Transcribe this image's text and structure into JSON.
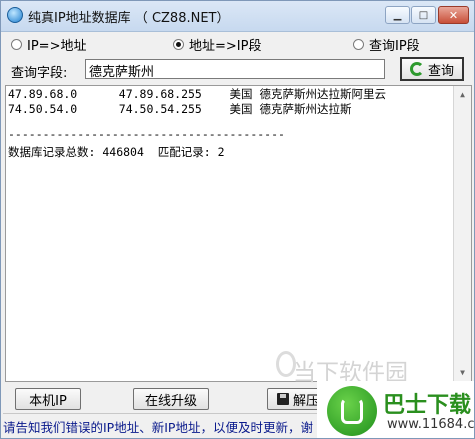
{
  "window": {
    "title": "纯真IP地址数据库 （ CZ88.NET）",
    "min_icon": "minimize-icon",
    "max_icon": "maximize-icon",
    "close_icon": "close-icon",
    "min_glyph": "▁",
    "max_glyph": "□",
    "close_glyph": "✕"
  },
  "modes": [
    {
      "label": "IP=>地址",
      "selected": false
    },
    {
      "label": "地址=>IP段",
      "selected": true
    },
    {
      "label": "查询IP段",
      "selected": false
    }
  ],
  "query": {
    "label": "查询字段:",
    "value": "德克萨斯州",
    "button": "查询",
    "button_icon": "refresh-icon"
  },
  "results": {
    "lines": [
      "47.89.68.0      47.89.68.255    美国 德克萨斯州达拉斯阿里云",
      "74.50.54.0      74.50.54.255    美国 德克萨斯州达拉斯",
      "",
      "----------------------------------------",
      "数据库记录总数: 446804  匹配记录: 2"
    ]
  },
  "buttons": {
    "local_ip": "本机IP",
    "online_update": "在线升级",
    "extract": "解压"
  },
  "status_text": "请告知我们错误的IP地址、新IP地址，以便及时更新，谢",
  "watermark": "当下软件园",
  "badge": {
    "title": "巴士下载",
    "url": "www.11684.com"
  },
  "colors": {
    "accent_green": "#2a8f1e",
    "status_blue": "#0a1a8c"
  }
}
